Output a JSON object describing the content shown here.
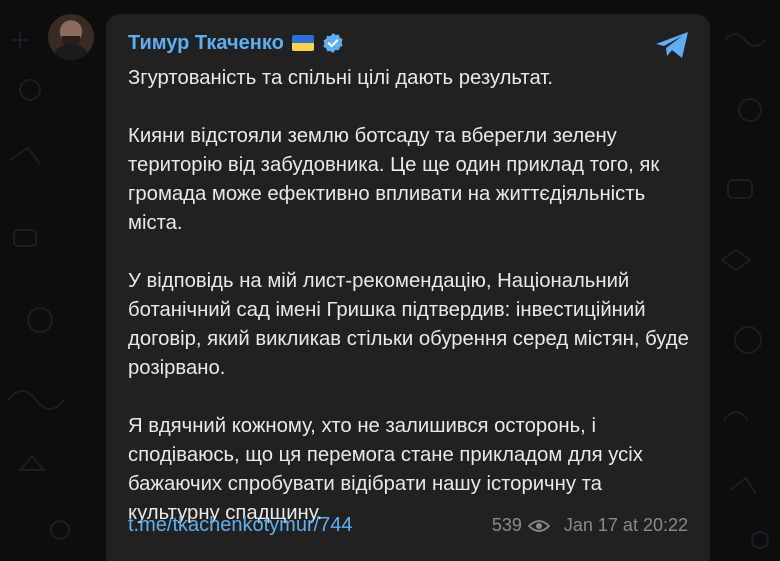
{
  "post": {
    "author": "Тимур Ткаченко",
    "paragraphs": [
      "Згуртованість та спільні цілі дають результат.",
      "Кияни відстояли землю ботсаду та вберегли зелену територію від забудовника. Це ще один приклад того, як громада може ефективно впливати на життєдіяльність міста.",
      "У відповідь на мій лист-рекомендацію, Національний ботанічний сад імені Гришка підтвердив: інвестиційний договір, який викликав стільки обурення серед містян, буде розірвано.",
      "Я вдячний кожному, хто не залишився осторонь, і сподіваюсь, що ця перемога стане прикладом для усіх бажаючих спробувати відібрати нашу історичну та культурну спадщину."
    ],
    "link": "t.me/tkachenkotymur/744",
    "views": "539",
    "timestamp": "Jan 17 at 20:22"
  },
  "icons": {
    "flag": "ukraine-flag-icon",
    "verified": "verified-badge-icon",
    "telegram": "telegram-plane-icon",
    "views": "eye-icon"
  },
  "colors": {
    "background": "#0c0d0f",
    "bubble": "#212121",
    "accent": "#5eaff2",
    "text": "#e9e9e9",
    "meta": "#8a8a8a"
  }
}
